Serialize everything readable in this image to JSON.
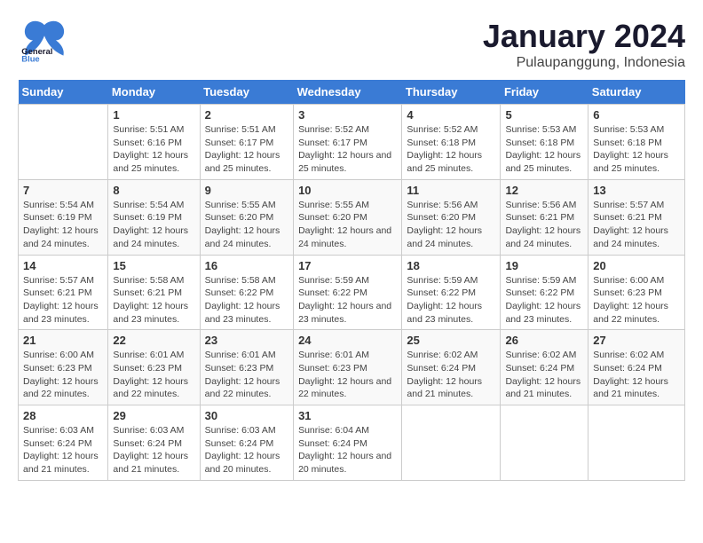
{
  "header": {
    "logo_general": "General",
    "logo_blue": "Blue",
    "title": "January 2024",
    "subtitle": "Pulaupanggung, Indonesia"
  },
  "weekdays": [
    "Sunday",
    "Monday",
    "Tuesday",
    "Wednesday",
    "Thursday",
    "Friday",
    "Saturday"
  ],
  "weeks": [
    [
      {
        "day": "",
        "info": ""
      },
      {
        "day": "1",
        "info": "Sunrise: 5:51 AM\nSunset: 6:16 PM\nDaylight: 12 hours\nand 25 minutes."
      },
      {
        "day": "2",
        "info": "Sunrise: 5:51 AM\nSunset: 6:17 PM\nDaylight: 12 hours\nand 25 minutes."
      },
      {
        "day": "3",
        "info": "Sunrise: 5:52 AM\nSunset: 6:17 PM\nDaylight: 12 hours\nand 25 minutes."
      },
      {
        "day": "4",
        "info": "Sunrise: 5:52 AM\nSunset: 6:18 PM\nDaylight: 12 hours\nand 25 minutes."
      },
      {
        "day": "5",
        "info": "Sunrise: 5:53 AM\nSunset: 6:18 PM\nDaylight: 12 hours\nand 25 minutes."
      },
      {
        "day": "6",
        "info": "Sunrise: 5:53 AM\nSunset: 6:18 PM\nDaylight: 12 hours\nand 25 minutes."
      }
    ],
    [
      {
        "day": "7",
        "info": "Sunrise: 5:54 AM\nSunset: 6:19 PM\nDaylight: 12 hours\nand 24 minutes."
      },
      {
        "day": "8",
        "info": "Sunrise: 5:54 AM\nSunset: 6:19 PM\nDaylight: 12 hours\nand 24 minutes."
      },
      {
        "day": "9",
        "info": "Sunrise: 5:55 AM\nSunset: 6:20 PM\nDaylight: 12 hours\nand 24 minutes."
      },
      {
        "day": "10",
        "info": "Sunrise: 5:55 AM\nSunset: 6:20 PM\nDaylight: 12 hours\nand 24 minutes."
      },
      {
        "day": "11",
        "info": "Sunrise: 5:56 AM\nSunset: 6:20 PM\nDaylight: 12 hours\nand 24 minutes."
      },
      {
        "day": "12",
        "info": "Sunrise: 5:56 AM\nSunset: 6:21 PM\nDaylight: 12 hours\nand 24 minutes."
      },
      {
        "day": "13",
        "info": "Sunrise: 5:57 AM\nSunset: 6:21 PM\nDaylight: 12 hours\nand 24 minutes."
      }
    ],
    [
      {
        "day": "14",
        "info": "Sunrise: 5:57 AM\nSunset: 6:21 PM\nDaylight: 12 hours\nand 23 minutes."
      },
      {
        "day": "15",
        "info": "Sunrise: 5:58 AM\nSunset: 6:21 PM\nDaylight: 12 hours\nand 23 minutes."
      },
      {
        "day": "16",
        "info": "Sunrise: 5:58 AM\nSunset: 6:22 PM\nDaylight: 12 hours\nand 23 minutes."
      },
      {
        "day": "17",
        "info": "Sunrise: 5:59 AM\nSunset: 6:22 PM\nDaylight: 12 hours\nand 23 minutes."
      },
      {
        "day": "18",
        "info": "Sunrise: 5:59 AM\nSunset: 6:22 PM\nDaylight: 12 hours\nand 23 minutes."
      },
      {
        "day": "19",
        "info": "Sunrise: 5:59 AM\nSunset: 6:22 PM\nDaylight: 12 hours\nand 23 minutes."
      },
      {
        "day": "20",
        "info": "Sunrise: 6:00 AM\nSunset: 6:23 PM\nDaylight: 12 hours\nand 22 minutes."
      }
    ],
    [
      {
        "day": "21",
        "info": "Sunrise: 6:00 AM\nSunset: 6:23 PM\nDaylight: 12 hours\nand 22 minutes."
      },
      {
        "day": "22",
        "info": "Sunrise: 6:01 AM\nSunset: 6:23 PM\nDaylight: 12 hours\nand 22 minutes."
      },
      {
        "day": "23",
        "info": "Sunrise: 6:01 AM\nSunset: 6:23 PM\nDaylight: 12 hours\nand 22 minutes."
      },
      {
        "day": "24",
        "info": "Sunrise: 6:01 AM\nSunset: 6:23 PM\nDaylight: 12 hours\nand 22 minutes."
      },
      {
        "day": "25",
        "info": "Sunrise: 6:02 AM\nSunset: 6:24 PM\nDaylight: 12 hours\nand 21 minutes."
      },
      {
        "day": "26",
        "info": "Sunrise: 6:02 AM\nSunset: 6:24 PM\nDaylight: 12 hours\nand 21 minutes."
      },
      {
        "day": "27",
        "info": "Sunrise: 6:02 AM\nSunset: 6:24 PM\nDaylight: 12 hours\nand 21 minutes."
      }
    ],
    [
      {
        "day": "28",
        "info": "Sunrise: 6:03 AM\nSunset: 6:24 PM\nDaylight: 12 hours\nand 21 minutes."
      },
      {
        "day": "29",
        "info": "Sunrise: 6:03 AM\nSunset: 6:24 PM\nDaylight: 12 hours\nand 21 minutes."
      },
      {
        "day": "30",
        "info": "Sunrise: 6:03 AM\nSunset: 6:24 PM\nDaylight: 12 hours\nand 20 minutes."
      },
      {
        "day": "31",
        "info": "Sunrise: 6:04 AM\nSunset: 6:24 PM\nDaylight: 12 hours\nand 20 minutes."
      },
      {
        "day": "",
        "info": ""
      },
      {
        "day": "",
        "info": ""
      },
      {
        "day": "",
        "info": ""
      }
    ]
  ]
}
